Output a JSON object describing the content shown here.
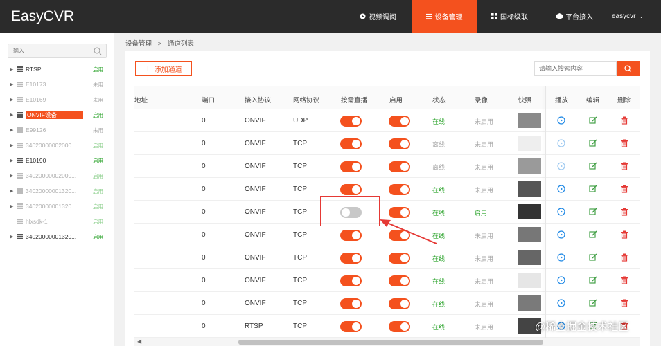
{
  "app": {
    "title": "EasyCVR"
  },
  "nav": {
    "items": [
      {
        "label": "视频调阅",
        "active": false
      },
      {
        "label": "设备管理",
        "active": true
      },
      {
        "label": "国标级联",
        "active": false
      },
      {
        "label": "平台接入",
        "active": false
      }
    ],
    "user": "easycvr"
  },
  "sidebar": {
    "search_placeholder": "输入",
    "items": [
      {
        "label": "RTSP",
        "status": "启用",
        "online": true
      },
      {
        "label": "E10173",
        "status": "未用",
        "online": false
      },
      {
        "label": "E10169",
        "status": "未用",
        "online": false
      },
      {
        "label": "ONVIF设备",
        "status": "启用",
        "online": true,
        "selected": true
      },
      {
        "label": "E99126",
        "status": "未用",
        "online": false
      },
      {
        "label": "34020000002000...",
        "status": "启用",
        "online": false
      },
      {
        "label": "E10190",
        "status": "启用",
        "online": true
      },
      {
        "label": "34020000002000...",
        "status": "启用",
        "online": false
      },
      {
        "label": "34020000001320...",
        "status": "启用",
        "online": false
      },
      {
        "label": "34020000001320...",
        "status": "启用",
        "online": false
      },
      {
        "label": "hlxsdk-1",
        "status": "启用",
        "online": false
      },
      {
        "label": "34020000001320...",
        "status": "启用",
        "online": true
      }
    ]
  },
  "breadcrumb": {
    "parent": "设备管理",
    "sep": ">",
    "current": "通道列表"
  },
  "toolbar": {
    "add_label": "添加通道",
    "search_placeholder": "请输入搜索内容"
  },
  "table": {
    "headers": {
      "addr": "地址",
      "port": "端口",
      "access": "接入协议",
      "net": "网络协议",
      "ondemand": "按需直播",
      "enable": "启用",
      "state": "状态",
      "record": "录像",
      "snapshot": "快照",
      "play": "播放",
      "edit": "编辑",
      "delete": "删除"
    },
    "rows": [
      {
        "port": "0",
        "access": "ONVIF",
        "net": "UDP",
        "ondemand": true,
        "enable": true,
        "state": "在线",
        "state_on": true,
        "record": "未启用",
        "record_on": false
      },
      {
        "port": "0",
        "access": "ONVIF",
        "net": "TCP",
        "ondemand": true,
        "enable": true,
        "state": "离线",
        "state_on": false,
        "record": "未启用",
        "record_on": false
      },
      {
        "port": "0",
        "access": "ONVIF",
        "net": "TCP",
        "ondemand": true,
        "enable": true,
        "state": "离线",
        "state_on": false,
        "record": "未启用",
        "record_on": false
      },
      {
        "port": "0",
        "access": "ONVIF",
        "net": "TCP",
        "ondemand": true,
        "enable": true,
        "state": "在线",
        "state_on": true,
        "record": "未启用",
        "record_on": false
      },
      {
        "port": "0",
        "access": "ONVIF",
        "net": "TCP",
        "ondemand": false,
        "enable": true,
        "state": "在线",
        "state_on": true,
        "record": "启用",
        "record_on": true
      },
      {
        "port": "0",
        "access": "ONVIF",
        "net": "TCP",
        "ondemand": true,
        "enable": true,
        "state": "在线",
        "state_on": true,
        "record": "未启用",
        "record_on": false
      },
      {
        "port": "0",
        "access": "ONVIF",
        "net": "TCP",
        "ondemand": true,
        "enable": true,
        "state": "在线",
        "state_on": true,
        "record": "未启用",
        "record_on": false
      },
      {
        "port": "0",
        "access": "ONVIF",
        "net": "TCP",
        "ondemand": true,
        "enable": true,
        "state": "在线",
        "state_on": true,
        "record": "未启用",
        "record_on": false
      },
      {
        "port": "0",
        "access": "ONVIF",
        "net": "TCP",
        "ondemand": true,
        "enable": true,
        "state": "在线",
        "state_on": true,
        "record": "未启用",
        "record_on": false
      },
      {
        "port": "0",
        "access": "RTSP",
        "net": "TCP",
        "ondemand": true,
        "enable": true,
        "state": "在线",
        "state_on": true,
        "record": "未启用",
        "record_on": false
      }
    ]
  },
  "watermark": "@稀土掘金技术社区",
  "colors": {
    "accent": "#f4511e",
    "online": "#2fa52f",
    "topbar": "#2b2b2b"
  }
}
